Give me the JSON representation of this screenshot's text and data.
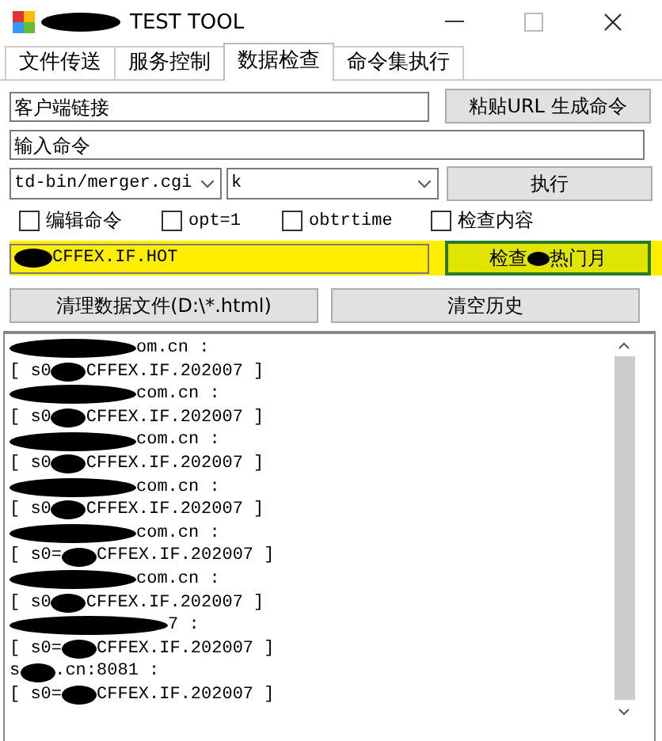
{
  "window": {
    "title": "TEST TOOL"
  },
  "tabs": [
    {
      "label": "文件传送",
      "selected": false
    },
    {
      "label": "服务控制",
      "selected": false
    },
    {
      "label": "数据检查",
      "selected": true
    },
    {
      "label": "命令集执行",
      "selected": false
    }
  ],
  "client_link": {
    "value": "客户端链接"
  },
  "paste_button": "粘贴URL  生成命令",
  "command_field": {
    "value": "输入命令"
  },
  "path_combo": {
    "value": "td-bin/merger.cgi"
  },
  "param_combo": {
    "value": "k"
  },
  "execute_button": "执行",
  "checkboxes": [
    {
      "label": "编辑命令",
      "checked": false
    },
    {
      "label": "opt=1",
      "checked": false
    },
    {
      "label": "obtrtime",
      "checked": false
    },
    {
      "label": "检查内容",
      "checked": false
    }
  ],
  "hot_field": {
    "value": "CFFEX.IF.HOT"
  },
  "hot_button": {
    "before": "检查",
    "after": "热门月"
  },
  "clear_files_button": "清理数据文件(D:\\*.html)",
  "clear_history_button": "清空历史",
  "log": [
    {
      "after": "om.cn :"
    },
    {
      "before": "[ s0",
      "after": "CFFEX.IF.202007 ]"
    },
    {
      "after": "com.cn :"
    },
    {
      "before": "[ s0",
      "after": "CFFEX.IF.202007 ]"
    },
    {
      "after": "com.cn :"
    },
    {
      "before": "[ s0",
      "after": "CFFEX.IF.202007 ]"
    },
    {
      "after": "com.cn :"
    },
    {
      "before": "[ s0",
      "after": "CFFEX.IF.202007 ]"
    },
    {
      "after": "com.cn :"
    },
    {
      "before": "[ s0=",
      "after": "CFFEX.IF.202007 ]"
    },
    {
      "after": "com.cn :"
    },
    {
      "before": "[ s0",
      "after": "CFFEX.IF.202007 ]"
    },
    {
      "after": "7 :"
    },
    {
      "before": "[ s0=",
      "after": "CFFEX.IF.202007 ]"
    },
    {
      "before": "s",
      "after": ".cn:8081 :"
    },
    {
      "before": "[ s0=",
      "after": "CFFEX.IF.202007 ]"
    }
  ]
}
